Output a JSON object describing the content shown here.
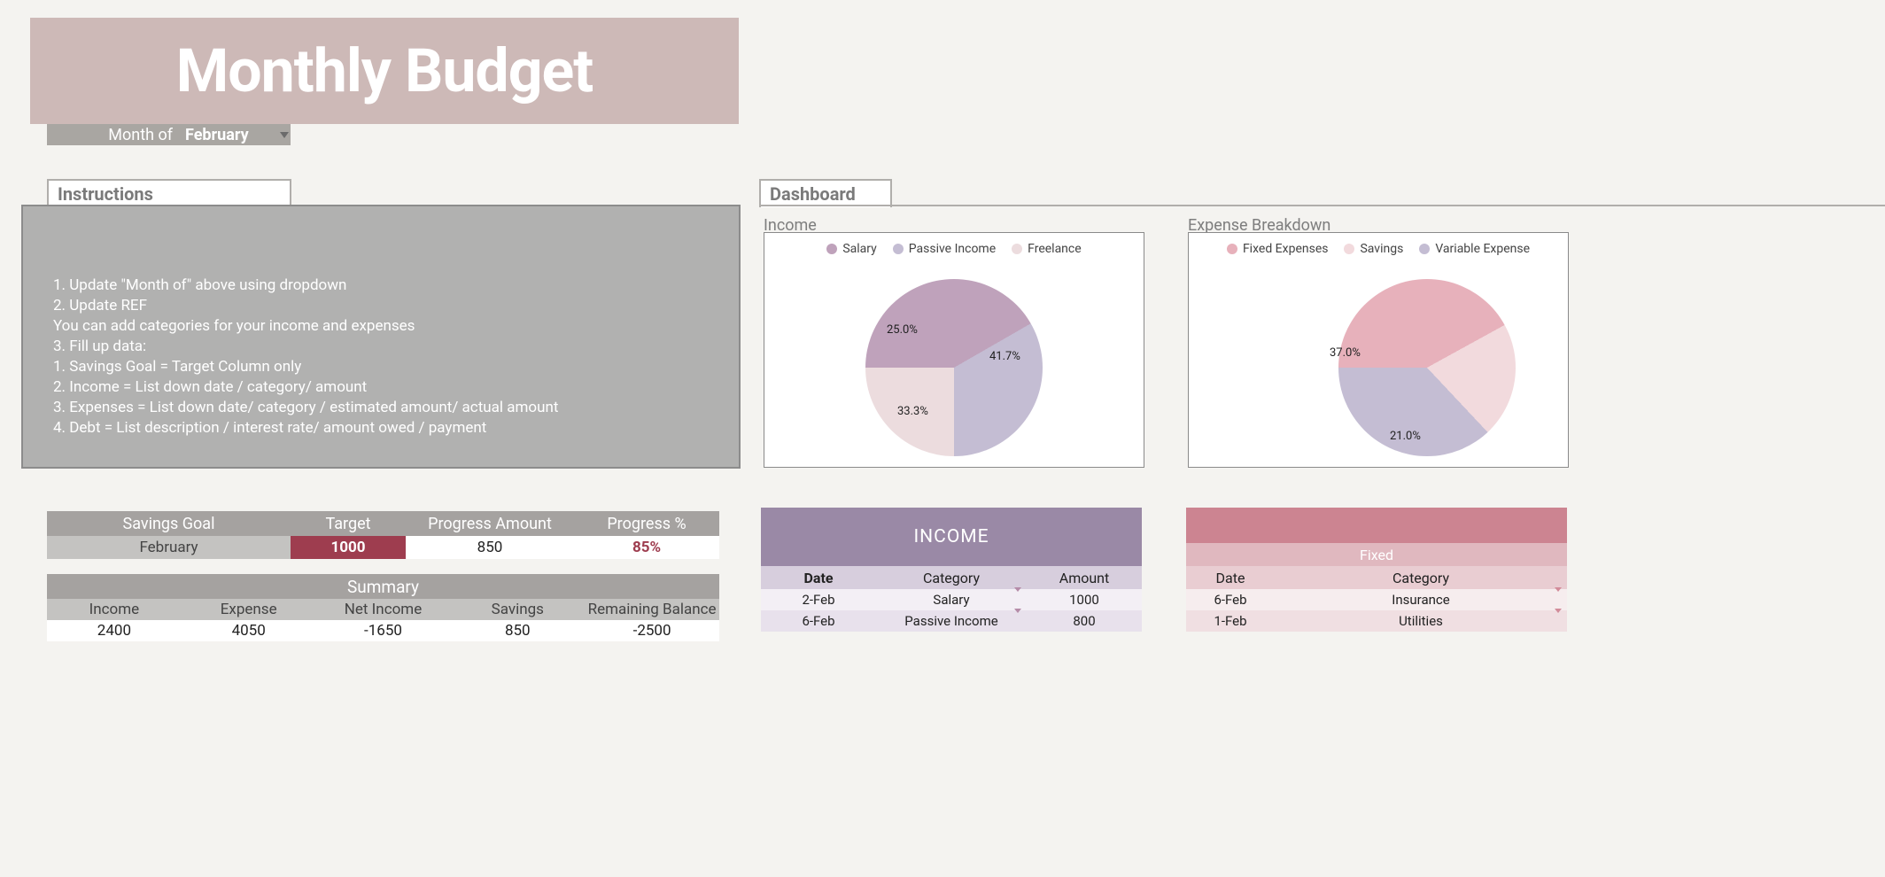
{
  "title": "Monthly Budget",
  "month_of_label": "Month of",
  "month_of_value": "February",
  "sections": {
    "instructions_tab": "Instructions",
    "dashboard_tab": "Dashboard"
  },
  "instructions": {
    "line1": "1. Update \"Month of\" above using dropdown",
    "line2": "2. Update REF",
    "line3": "You can add categories for your income and expenses",
    "line4": "",
    "line5": "3. Fill up data:",
    "line6": "1. Savings Goal = Target Column only",
    "line7": "2. Income = List down date / category/ amount",
    "line8": "3. Expenses = List down date/ category / estimated amount/ actual amount",
    "line9": "4. Debt = List description / interest rate/ amount owed / payment"
  },
  "savings": {
    "headers": {
      "goal": "Savings Goal",
      "target": "Target",
      "progress_amount": "Progress Amount",
      "progress_pct": "Progress %"
    },
    "month": "February",
    "target": "1000",
    "progress_amount": "850",
    "progress_pct": "85%"
  },
  "summary": {
    "title": "Summary",
    "headers": {
      "income": "Income",
      "expense": "Expense",
      "net": "Net Income",
      "savings": "Savings",
      "remaining": "Remaining Balance"
    },
    "values": {
      "income": "2400",
      "expense": "4050",
      "net": "-1650",
      "savings": "850",
      "remaining": "-2500"
    }
  },
  "dashboard": {
    "income_label": "Income",
    "expense_label": "Expense Breakdown",
    "income_legend": {
      "salary": "Salary",
      "passive": "Passive Income",
      "freelance": "Freelance"
    },
    "expense_legend": {
      "fixed": "Fixed Expenses",
      "savings": "Savings",
      "variable": "Variable Expense"
    },
    "income_pie_labels": {
      "salary": "41.7%",
      "passive": "33.3%",
      "freelance": "25.0%"
    },
    "expense_pie_labels": {
      "variable": "37.0%",
      "savings": "21.0%"
    }
  },
  "chart_data": [
    {
      "type": "pie",
      "title": "Income",
      "series": [
        {
          "name": "Salary",
          "value": 41.7,
          "color": "#bfa2bb"
        },
        {
          "name": "Passive Income",
          "value": 33.3,
          "color": "#c4bdd3"
        },
        {
          "name": "Freelance",
          "value": 25.0,
          "color": "#ecdcde"
        }
      ]
    },
    {
      "type": "pie",
      "title": "Expense Breakdown",
      "series": [
        {
          "name": "Fixed Expenses",
          "value": 42.0,
          "color": "#e7b1bb"
        },
        {
          "name": "Savings",
          "value": 21.0,
          "color": "#f2dadd"
        },
        {
          "name": "Variable Expense",
          "value": 37.0,
          "color": "#c4bdd3"
        }
      ]
    }
  ],
  "income_table": {
    "title": "INCOME",
    "headers": {
      "date": "Date",
      "category": "Category",
      "amount": "Amount"
    },
    "rows": [
      {
        "date": "2-Feb",
        "category": "Salary",
        "amount": "1000"
      },
      {
        "date": "6-Feb",
        "category": "Passive Income",
        "amount": "800"
      }
    ]
  },
  "fixed_table": {
    "sub": "Fixed",
    "headers": {
      "date": "Date",
      "category": "Category"
    },
    "rows": [
      {
        "date": "6-Feb",
        "category": "Insurance"
      },
      {
        "date": "1-Feb",
        "category": "Utilities"
      }
    ]
  },
  "colors": {
    "salary": "#bfa2bb",
    "passive": "#c4bdd3",
    "freelance": "#ecdcde",
    "fixed": "#e7b1bb",
    "savings_slice": "#f2dadd",
    "variable": "#c4bdd3"
  }
}
